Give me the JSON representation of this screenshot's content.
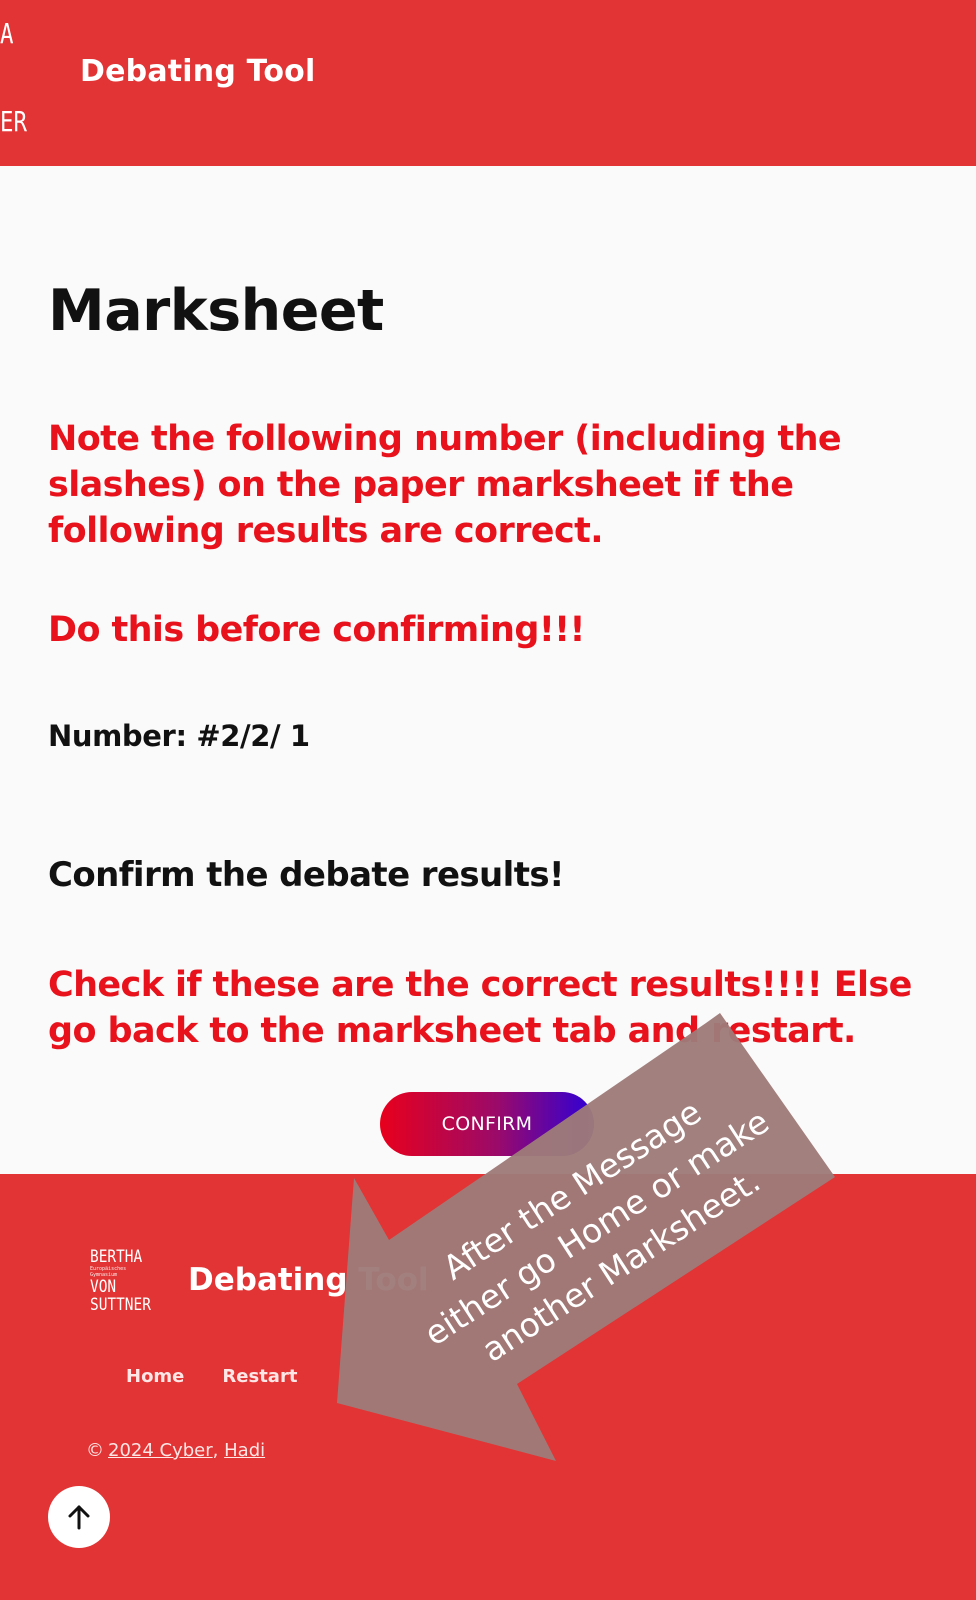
{
  "header": {
    "logo_top": "A",
    "logo_bottom": "ER",
    "title": "Debating Tool"
  },
  "main": {
    "title": "Marksheet",
    "note": "Note the following number (including the slashes) on the paper marksheet if the following results are correct.",
    "warning": "Do this before confirming!!!",
    "number_text": "Number: #2/2/ 1",
    "confirm_heading": "Confirm the debate results!",
    "check_text": "Check if these are the correct results!!!! Else go back to the marksheet tab and restart.",
    "confirm_label": "CONFIRM"
  },
  "footer": {
    "logo_line1": "BERTHA",
    "logo_small1": "Europäisches",
    "logo_small2": "Gymnasium",
    "logo_line2": "VON",
    "logo_line3": "SUTTNER",
    "title": "Debating Tool",
    "nav": [
      "Home",
      "Restart"
    ],
    "copyright_symbol": "©",
    "copyright_link1": "2024  Cyber",
    "copyright_sep": ",",
    "copyright_link2": "Hadi"
  },
  "annotation": {
    "line1": "After the Message",
    "line2": "either go Home or make",
    "line3": "another Marksheet.",
    "color": "#9e7b79"
  },
  "icons": {
    "to_top": "arrow-up-icon"
  },
  "colors": {
    "brand_red": "#e23434",
    "text_red": "#e8121c",
    "button_gradient_start": "#e8001c",
    "button_gradient_end": "#2d00d8"
  }
}
